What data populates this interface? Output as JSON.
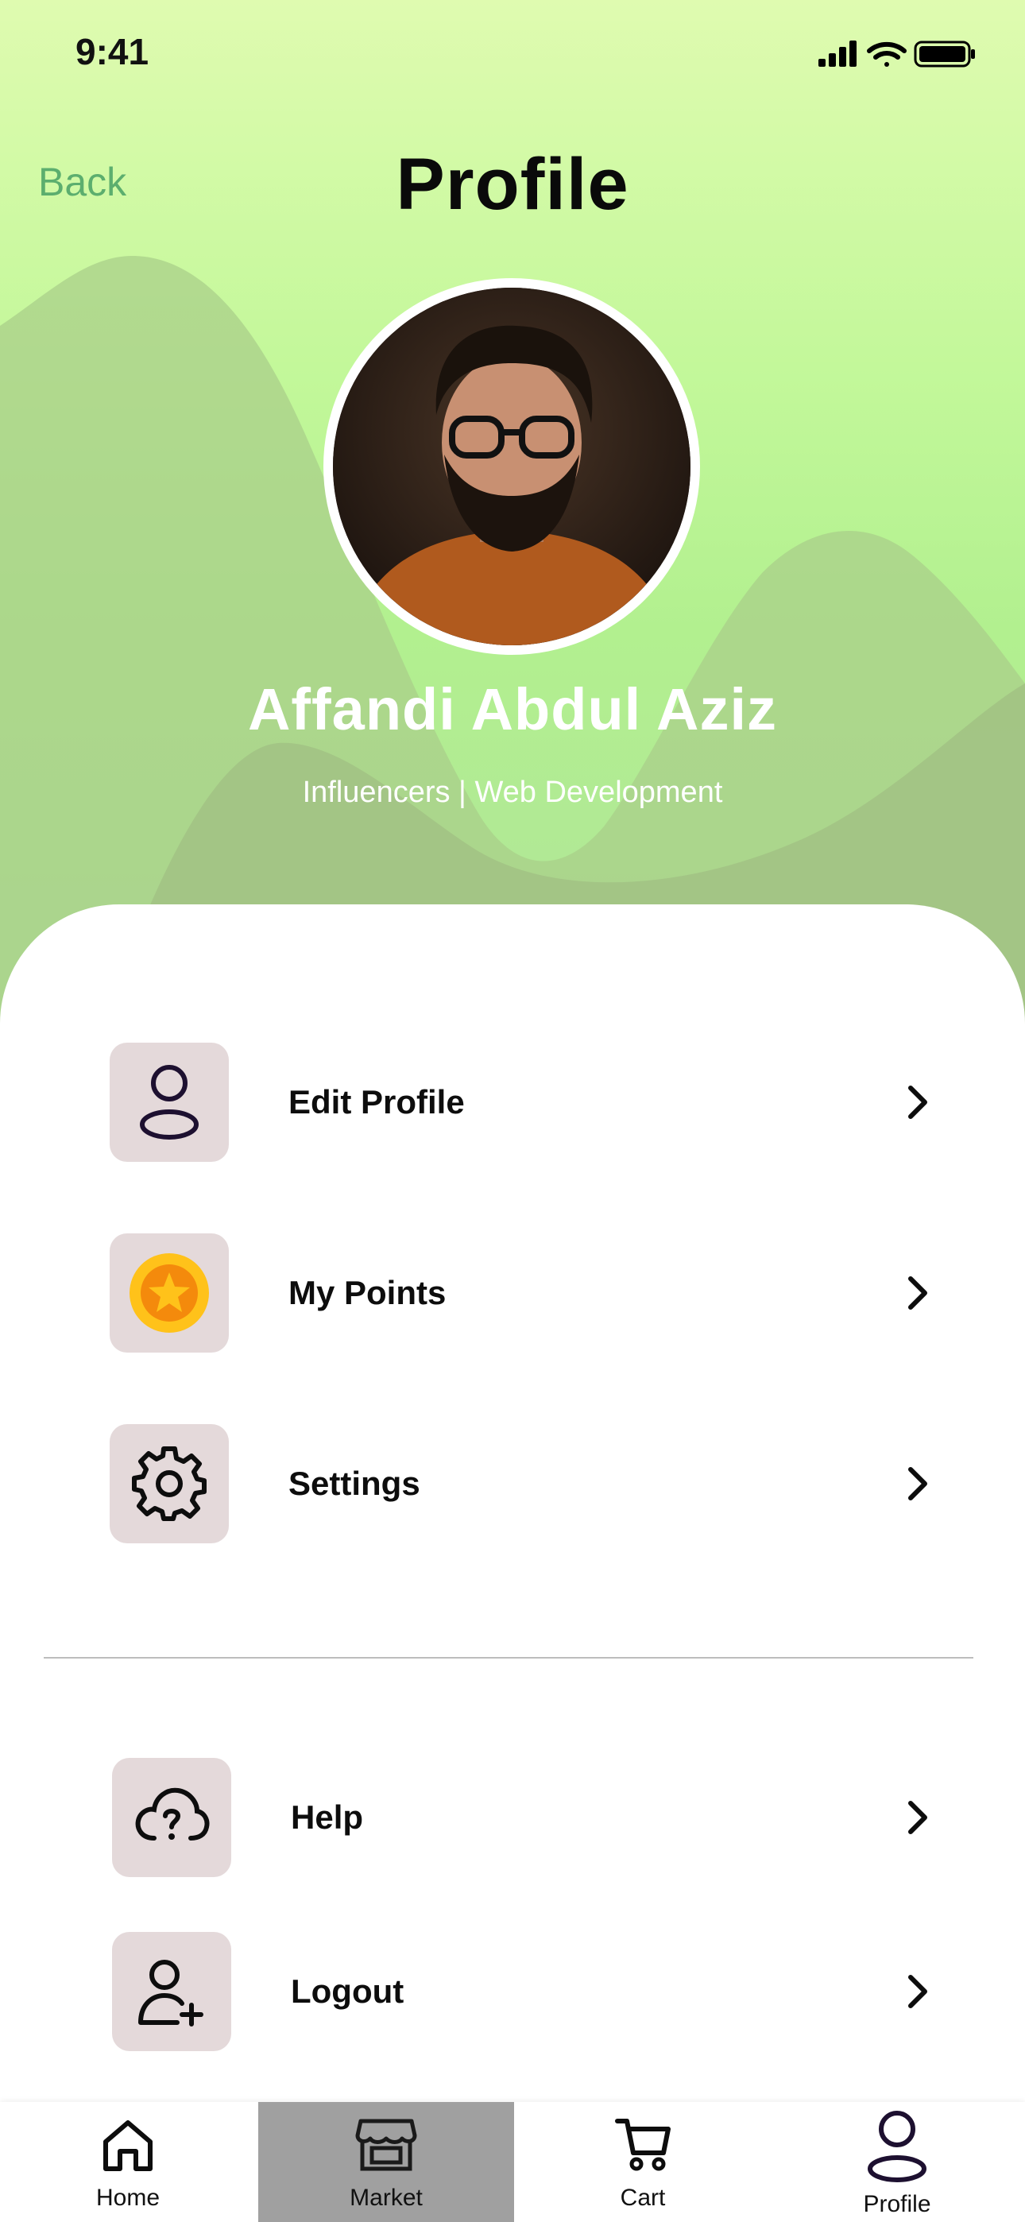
{
  "status_bar": {
    "time": "9:41",
    "icons": [
      "signal-icon",
      "wifi-icon",
      "battery-icon"
    ]
  },
  "header": {
    "back_label": "Back",
    "title": "Profile"
  },
  "profile": {
    "name": "Affandi Abdul Aziz",
    "role": "Influencers | Web Development"
  },
  "menu": {
    "items": [
      {
        "label": "Edit Profile",
        "icon": "user-icon"
      },
      {
        "label": "My Points",
        "icon": "star-coin-icon"
      },
      {
        "label": "Settings",
        "icon": "gear-icon"
      },
      {
        "label": "Help",
        "icon": "cloud-question-icon"
      },
      {
        "label": "Logout",
        "icon": "user-add-icon"
      }
    ]
  },
  "tabbar": {
    "tabs": [
      {
        "label": "Home",
        "icon": "home-icon"
      },
      {
        "label": "Market",
        "icon": "store-icon"
      },
      {
        "label": "Cart",
        "icon": "cart-icon"
      },
      {
        "label": "Profile",
        "icon": "user-icon"
      }
    ],
    "active_tab": "Market"
  },
  "colors": {
    "hero_top": "#dffbb0",
    "hero_mid": "#b2f08f",
    "back_link": "#5cae6e",
    "icon_box": "#e4d9da",
    "active_tab": "#a0a0a0"
  }
}
